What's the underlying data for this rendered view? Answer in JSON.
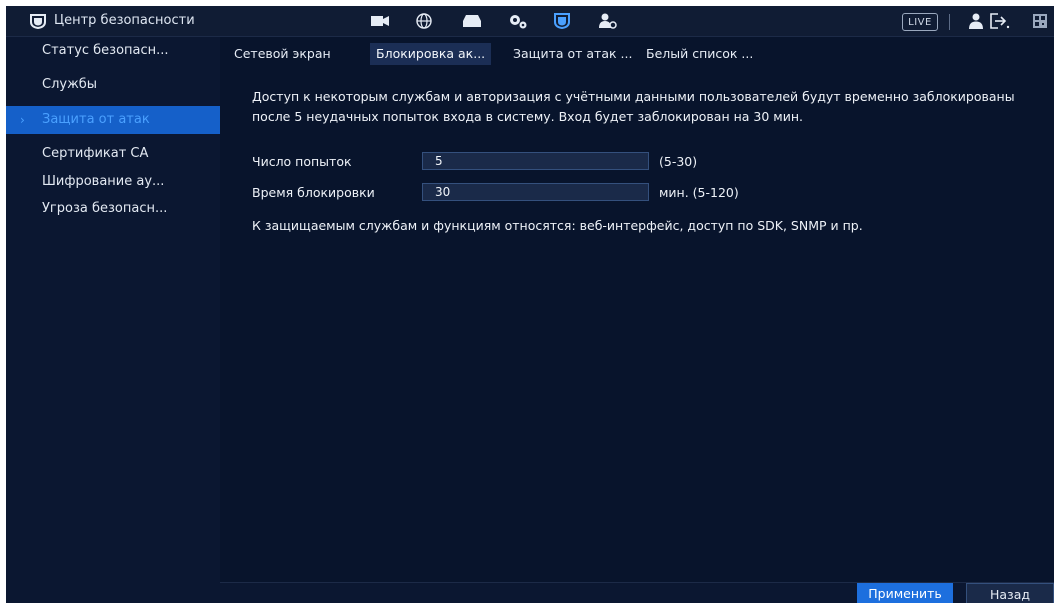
{
  "header": {
    "title": "Центр безопасности",
    "live_label": "LIVE",
    "icons": [
      "shield-icon",
      "camera-icon",
      "globe-icon",
      "storage-icon",
      "settings-icon",
      "security-icon",
      "account-icon",
      "user-icon",
      "logout-icon",
      "qr-icon"
    ],
    "accent_color": "#4aa0ff"
  },
  "sidebar": {
    "items": [
      {
        "label": "Статус безопасн..."
      },
      {
        "label": "Службы"
      },
      {
        "label": "Защита от атак"
      },
      {
        "label": "Сертификат CA"
      },
      {
        "label": "Шифрование ау..."
      },
      {
        "label": "Угроза безопасн..."
      }
    ],
    "active_index": 2
  },
  "tabs": [
    {
      "label": "Сетевой экран"
    },
    {
      "label": "Блокировка ак..."
    },
    {
      "label": "Защита от атак ..."
    },
    {
      "label": "Белый список ..."
    }
  ],
  "main": {
    "description": "Доступ к некоторым службам и авторизация с учётными данными пользователей будут временно заблокированы после 5 неудачных попыток входа в систему. Вход будет заблокирован на 30 мин.",
    "attempts_label": "Число попыток",
    "attempts_value": "5",
    "attempts_hint": "(5-30)",
    "lock_label": "Время блокировки",
    "lock_value": "30",
    "lock_hint": "мин. (5-120)",
    "note": "К защищаемым службам и функциям относятся: веб-интерфейс, доступ по SDK, SNMP и пр."
  },
  "buttons": {
    "apply": "Применить",
    "back": "Назад"
  }
}
